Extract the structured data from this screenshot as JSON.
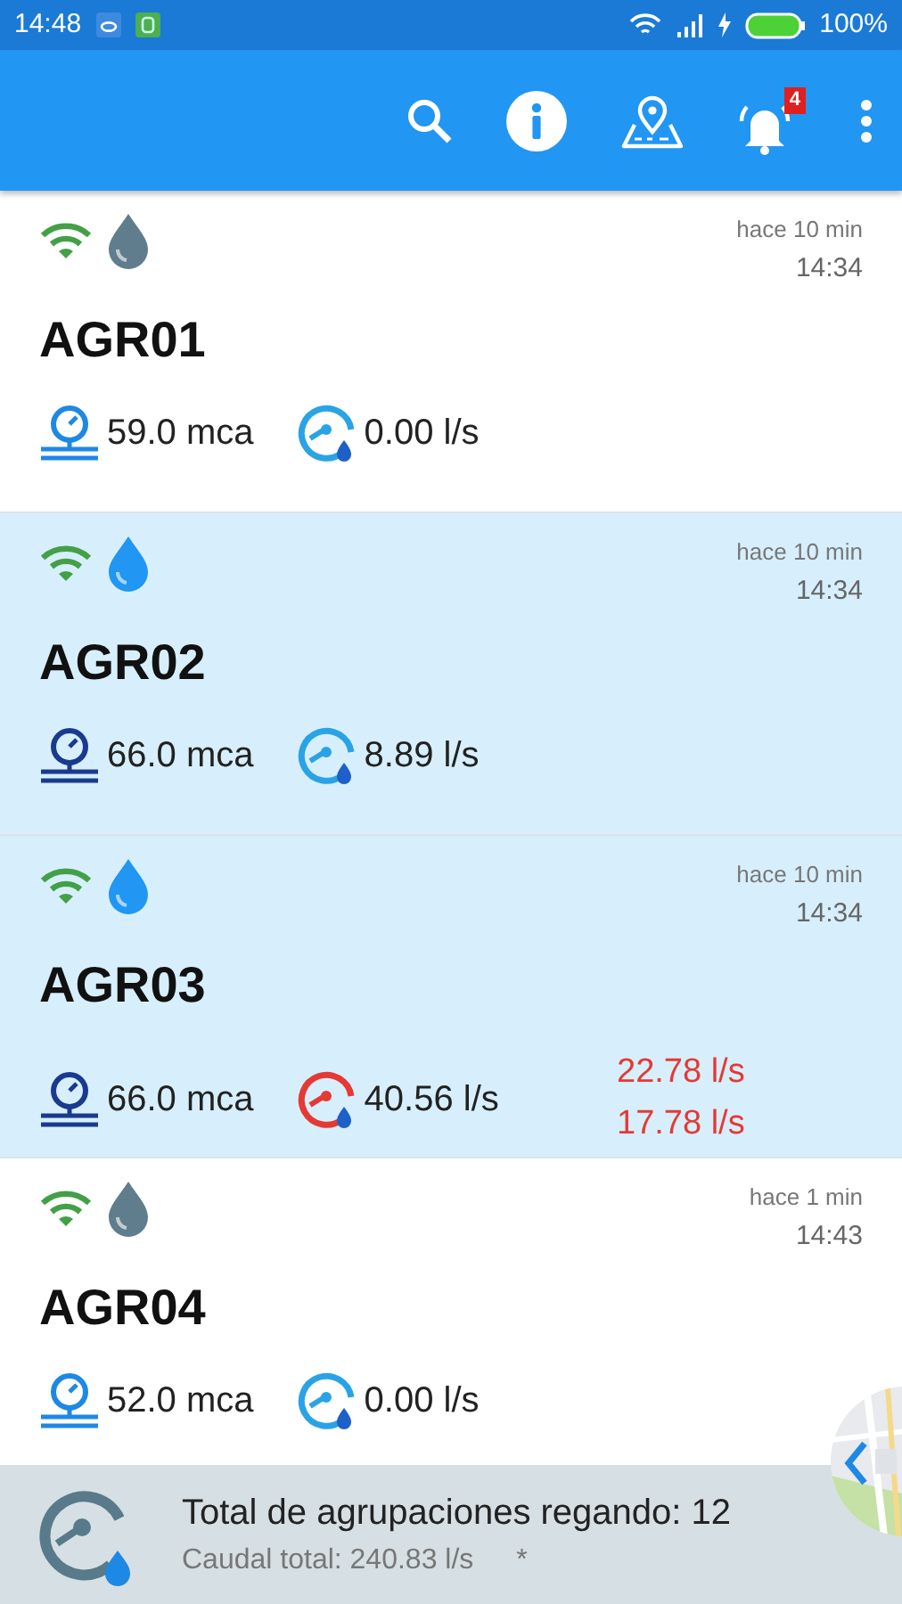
{
  "status_bar": {
    "time": "14:48",
    "battery": "100%"
  },
  "toolbar": {
    "notifications_count": "4"
  },
  "groups": [
    {
      "name": "AGR01",
      "ago": "hace 10 min",
      "time": "14:34",
      "irrigating": false,
      "pressure": "59.0 mca",
      "flow": "0.00 l/s",
      "flow_alarm": false
    },
    {
      "name": "AGR02",
      "ago": "hace 10 min",
      "time": "14:34",
      "irrigating": true,
      "pressure": "66.0 mca",
      "flow": "8.89 l/s",
      "flow_alarm": false
    },
    {
      "name": "AGR03",
      "ago": "hace 10 min",
      "time": "14:34",
      "irrigating": true,
      "pressure": "66.0 mca",
      "flow": "40.56 l/s",
      "flow_alarm": true,
      "extra_flows": [
        "22.78 l/s",
        "17.78 l/s"
      ]
    },
    {
      "name": "AGR04",
      "ago": "hace 1 min",
      "time": "14:43",
      "irrigating": false,
      "pressure": "52.0 mca",
      "flow": "0.00 l/s",
      "flow_alarm": false
    }
  ],
  "footer": {
    "title": "Total de agrupaciones regando: 12",
    "subtitle": "Caudal total: 240.83 l/s",
    "note": "*"
  }
}
